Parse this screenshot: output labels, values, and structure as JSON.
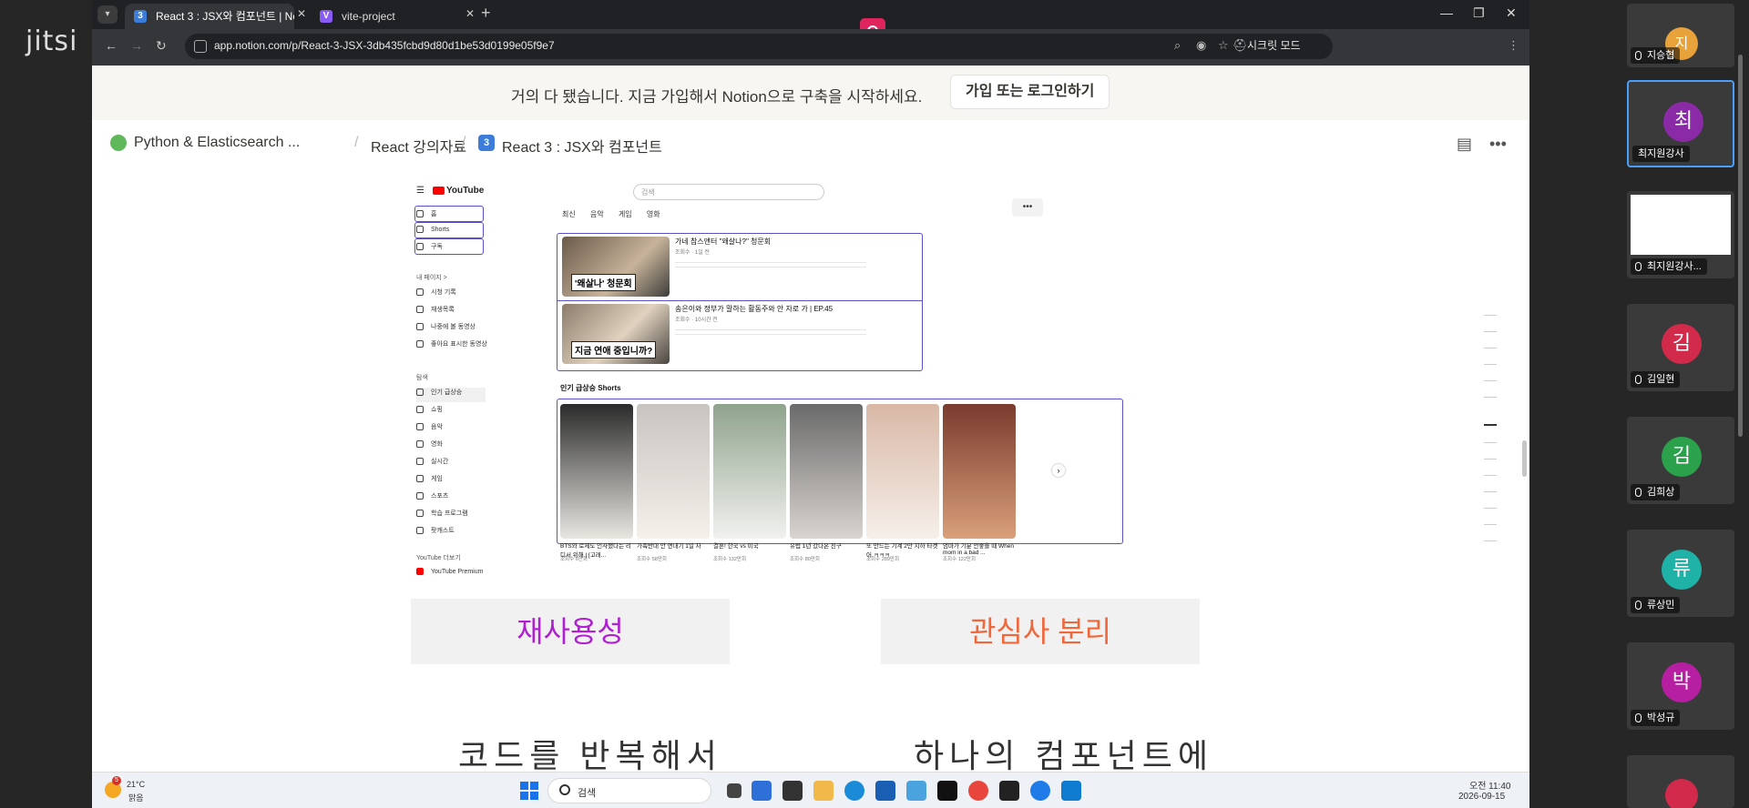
{
  "jitsi": {
    "logo": "jitsi"
  },
  "browser": {
    "tabs": [
      {
        "label": "React 3 : JSX와 컴포넌트 | Not",
        "favicon": "3",
        "active": true
      },
      {
        "label": "vite-project",
        "favicon": "V",
        "active": false
      }
    ],
    "url": "app.notion.com/p/React-3-JSX-3db435fcbd9d80d1be53d0199e05f9e7",
    "secret_mode": "시크릿 모드"
  },
  "notion": {
    "banner_text": "거의 다 됐습니다. 지금 가입해서 Notion으로 구축을 시작하세요.",
    "banner_button": "가입 또는 로그인하기",
    "breadcrumbs": [
      "Python & Elasticsearch ...",
      "React 강의자료",
      "React 3 : JSX와 컴포넌트"
    ],
    "breadcrumb_icon": "3"
  },
  "youtube": {
    "logo": "YouTube",
    "search_placeholder": "검색",
    "chips": [
      "최신",
      "음악",
      "게임",
      "영화"
    ],
    "sidebar_top": [
      "홈",
      "Shorts",
      "구독"
    ],
    "sidebar_me_header": "내 페이지 >",
    "sidebar_me": [
      "시청 기록",
      "재생목록",
      "나중에 볼 동영상",
      "좋아요 표시한 동영상"
    ],
    "sidebar_explore_header": "탐색",
    "sidebar_explore": [
      "인기 급상승",
      "쇼핑",
      "음악",
      "영화",
      "실시간",
      "게임",
      "스포츠",
      "학습 프로그램",
      "팟캐스트"
    ],
    "sidebar_more_header": "YouTube 더보기",
    "sidebar_premium": "YouTube Premium",
    "videos": [
      {
        "title": "가네 참스앤터 \"왜살나?\" 청문회",
        "meta": "조회수 · 1일 전",
        "caption": "'왜살나' 청문회"
      },
      {
        "title": "송은이와 정부가 말하는 활동주와 안 자로 가 | EP.45",
        "meta": "조회수 · 10시간 전",
        "caption": "지금 연애 중입니까?"
      }
    ],
    "shorts_title": "인기 급상승 Shorts",
    "shorts": [
      {
        "label": "BTS와 로제도 인사했다는 리디서 위해 | [고래...",
        "meta": "조회수 6만회",
        "color1": "#2b2b2b",
        "color2": "#e8e6e1"
      },
      {
        "label": "가족반대 안 연내기 1일 차",
        "meta": "조회수 58만회",
        "color1": "#c9c4c0",
        "color2": "#f4f0ea"
      },
      {
        "label": "결혼! 한국 vs 미국",
        "meta": "조회수 132만회",
        "color1": "#8fa38c",
        "color2": "#f2f2f0"
      },
      {
        "label": "유럽 1년 갔다온 친구",
        "meta": "조회수 80만회",
        "color1": "#6a6a6a",
        "color2": "#d9d4cf"
      },
      {
        "label": "또 만드는 기계 2만 지하 타겟어 ㅋㅋㅋ",
        "meta": "조회수 289만회",
        "color1": "#d9b8a6",
        "color2": "#f6efea"
      },
      {
        "label": "엄마가 기분 안좋을 때 When mom in a bad ...",
        "meta": "조회수 122만회",
        "color1": "#7a3b2e",
        "color2": "#d9a07a"
      }
    ]
  },
  "slide": {
    "card_left": "재사용성",
    "card_left_color": "#b01fd1",
    "card_right": "관심사 분리",
    "card_right_color": "#f0673a",
    "text_left": "코드를 반복해서",
    "text_right": "하나의 컴포넌트에"
  },
  "taskbar": {
    "weather_temp": "21°C",
    "weather_cond": "맑음",
    "weather_badge": "5",
    "search": "검색",
    "time": "오전 11:40",
    "date": "2026-09-15"
  },
  "participants": [
    {
      "initial": "지",
      "name": "지승협",
      "color": "#e8a23a"
    },
    {
      "initial": "최",
      "name": "최지원강사",
      "color": "#8a2aa6",
      "active": true
    },
    {
      "initial": "",
      "name": "최지원강사...",
      "screen": true
    },
    {
      "initial": "김",
      "name": "김일현",
      "color": "#d12a4a"
    },
    {
      "initial": "김",
      "name": "김희상",
      "color": "#2aa14a"
    },
    {
      "initial": "류",
      "name": "류상민",
      "color": "#1fb3a8"
    },
    {
      "initial": "박",
      "name": "박성규",
      "color": "#b71fa3"
    }
  ]
}
